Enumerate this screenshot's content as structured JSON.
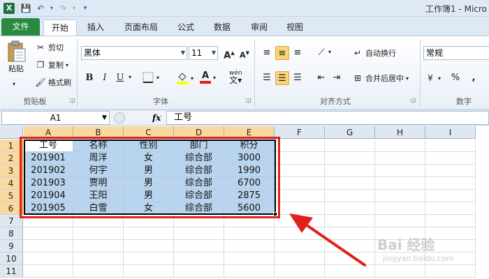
{
  "window": {
    "title": "工作簿1 - Micro"
  },
  "quick_access": {
    "app_icon": "excel-icon",
    "app_icon_glyph": "X",
    "save_icon": "💾",
    "undo_icon": "↶",
    "redo_icon": "↷",
    "more_icon": "▾"
  },
  "ribbon_tabs": [
    {
      "label": "文件"
    },
    {
      "label": "开始"
    },
    {
      "label": "插入"
    },
    {
      "label": "页面布局"
    },
    {
      "label": "公式"
    },
    {
      "label": "数据"
    },
    {
      "label": "审阅"
    },
    {
      "label": "视图"
    }
  ],
  "clipboard": {
    "paste": "粘贴",
    "cut": "剪切",
    "copy": "复制",
    "format_painter": "格式刷",
    "label": "剪贴板"
  },
  "font": {
    "name": "黑体",
    "size": "11",
    "grow": "A",
    "shrink": "A",
    "bold": "B",
    "italic": "I",
    "underline": "U",
    "color_a": "A",
    "phonetic": "wén",
    "label": "字体"
  },
  "alignment": {
    "wrap": "自动换行",
    "merge": "合并后居中",
    "label": "对齐方式"
  },
  "number": {
    "format": "常规",
    "percent": "%",
    "comma": ",",
    "label": "数字"
  },
  "formula_bar": {
    "name_box": "A1",
    "fx": "fx",
    "content": "工号"
  },
  "columns": [
    "A",
    "B",
    "C",
    "D",
    "E",
    "F",
    "G",
    "H",
    "I"
  ],
  "rows": [
    "1",
    "2",
    "3",
    "4",
    "5",
    "6",
    "7",
    "8",
    "9",
    "10",
    "11"
  ],
  "table": {
    "headers": [
      "工号",
      "名称",
      "性别",
      "部门",
      "积分"
    ],
    "rows": [
      [
        "201901",
        "周洋",
        "女",
        "综合部",
        "3000"
      ],
      [
        "201902",
        "何宇",
        "男",
        "综合部",
        "1990"
      ],
      [
        "201903",
        "贾明",
        "男",
        "综合部",
        "6700"
      ],
      [
        "201904",
        "王阳",
        "男",
        "综合部",
        "2875"
      ],
      [
        "201905",
        "白雪",
        "女",
        "综合部",
        "5600"
      ]
    ]
  },
  "colors": {
    "selection_fill": "#b9d4ee",
    "highlight_border": "#e0201b",
    "header_selected": "#f9d99f"
  },
  "watermark": {
    "text": "Bai  经验",
    "sub": "jingyan.baidu.com"
  }
}
